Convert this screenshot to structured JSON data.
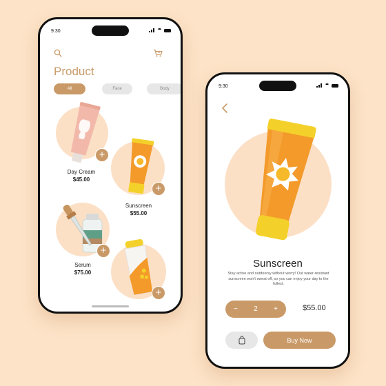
{
  "colors": {
    "accent": "#c99a68",
    "background": "#fde3c8",
    "circle": "#fce0c6"
  },
  "status": {
    "time": "9:30"
  },
  "list_screen": {
    "title": "Product",
    "search_icon": "search-icon",
    "cart_icon": "cart-icon",
    "categories": [
      {
        "label": "All",
        "active": true
      },
      {
        "label": "Face",
        "active": false
      },
      {
        "label": "Body",
        "active": false
      }
    ],
    "products": [
      {
        "name": "Day Cream",
        "price": "$45.00",
        "add_label": "+"
      },
      {
        "name": "Sunscreen",
        "price": "$55.00",
        "add_label": "+"
      },
      {
        "name": "Serum",
        "price": "$75.00",
        "add_label": "+"
      },
      {
        "name": "",
        "price": "",
        "add_label": "+"
      }
    ]
  },
  "detail_screen": {
    "back_icon": "chevron-left-icon",
    "title": "Sunscreen",
    "description": "Stay active and outdoorsy without worry! Our water-resistant sunscreen won't sweat off, so you can enjoy your day to the fullest.",
    "quantity": "2",
    "minus_label": "−",
    "plus_label": "+",
    "price": "$55.00",
    "bag_icon": "shopping-bag-icon",
    "buy_label": "Buy Now"
  }
}
